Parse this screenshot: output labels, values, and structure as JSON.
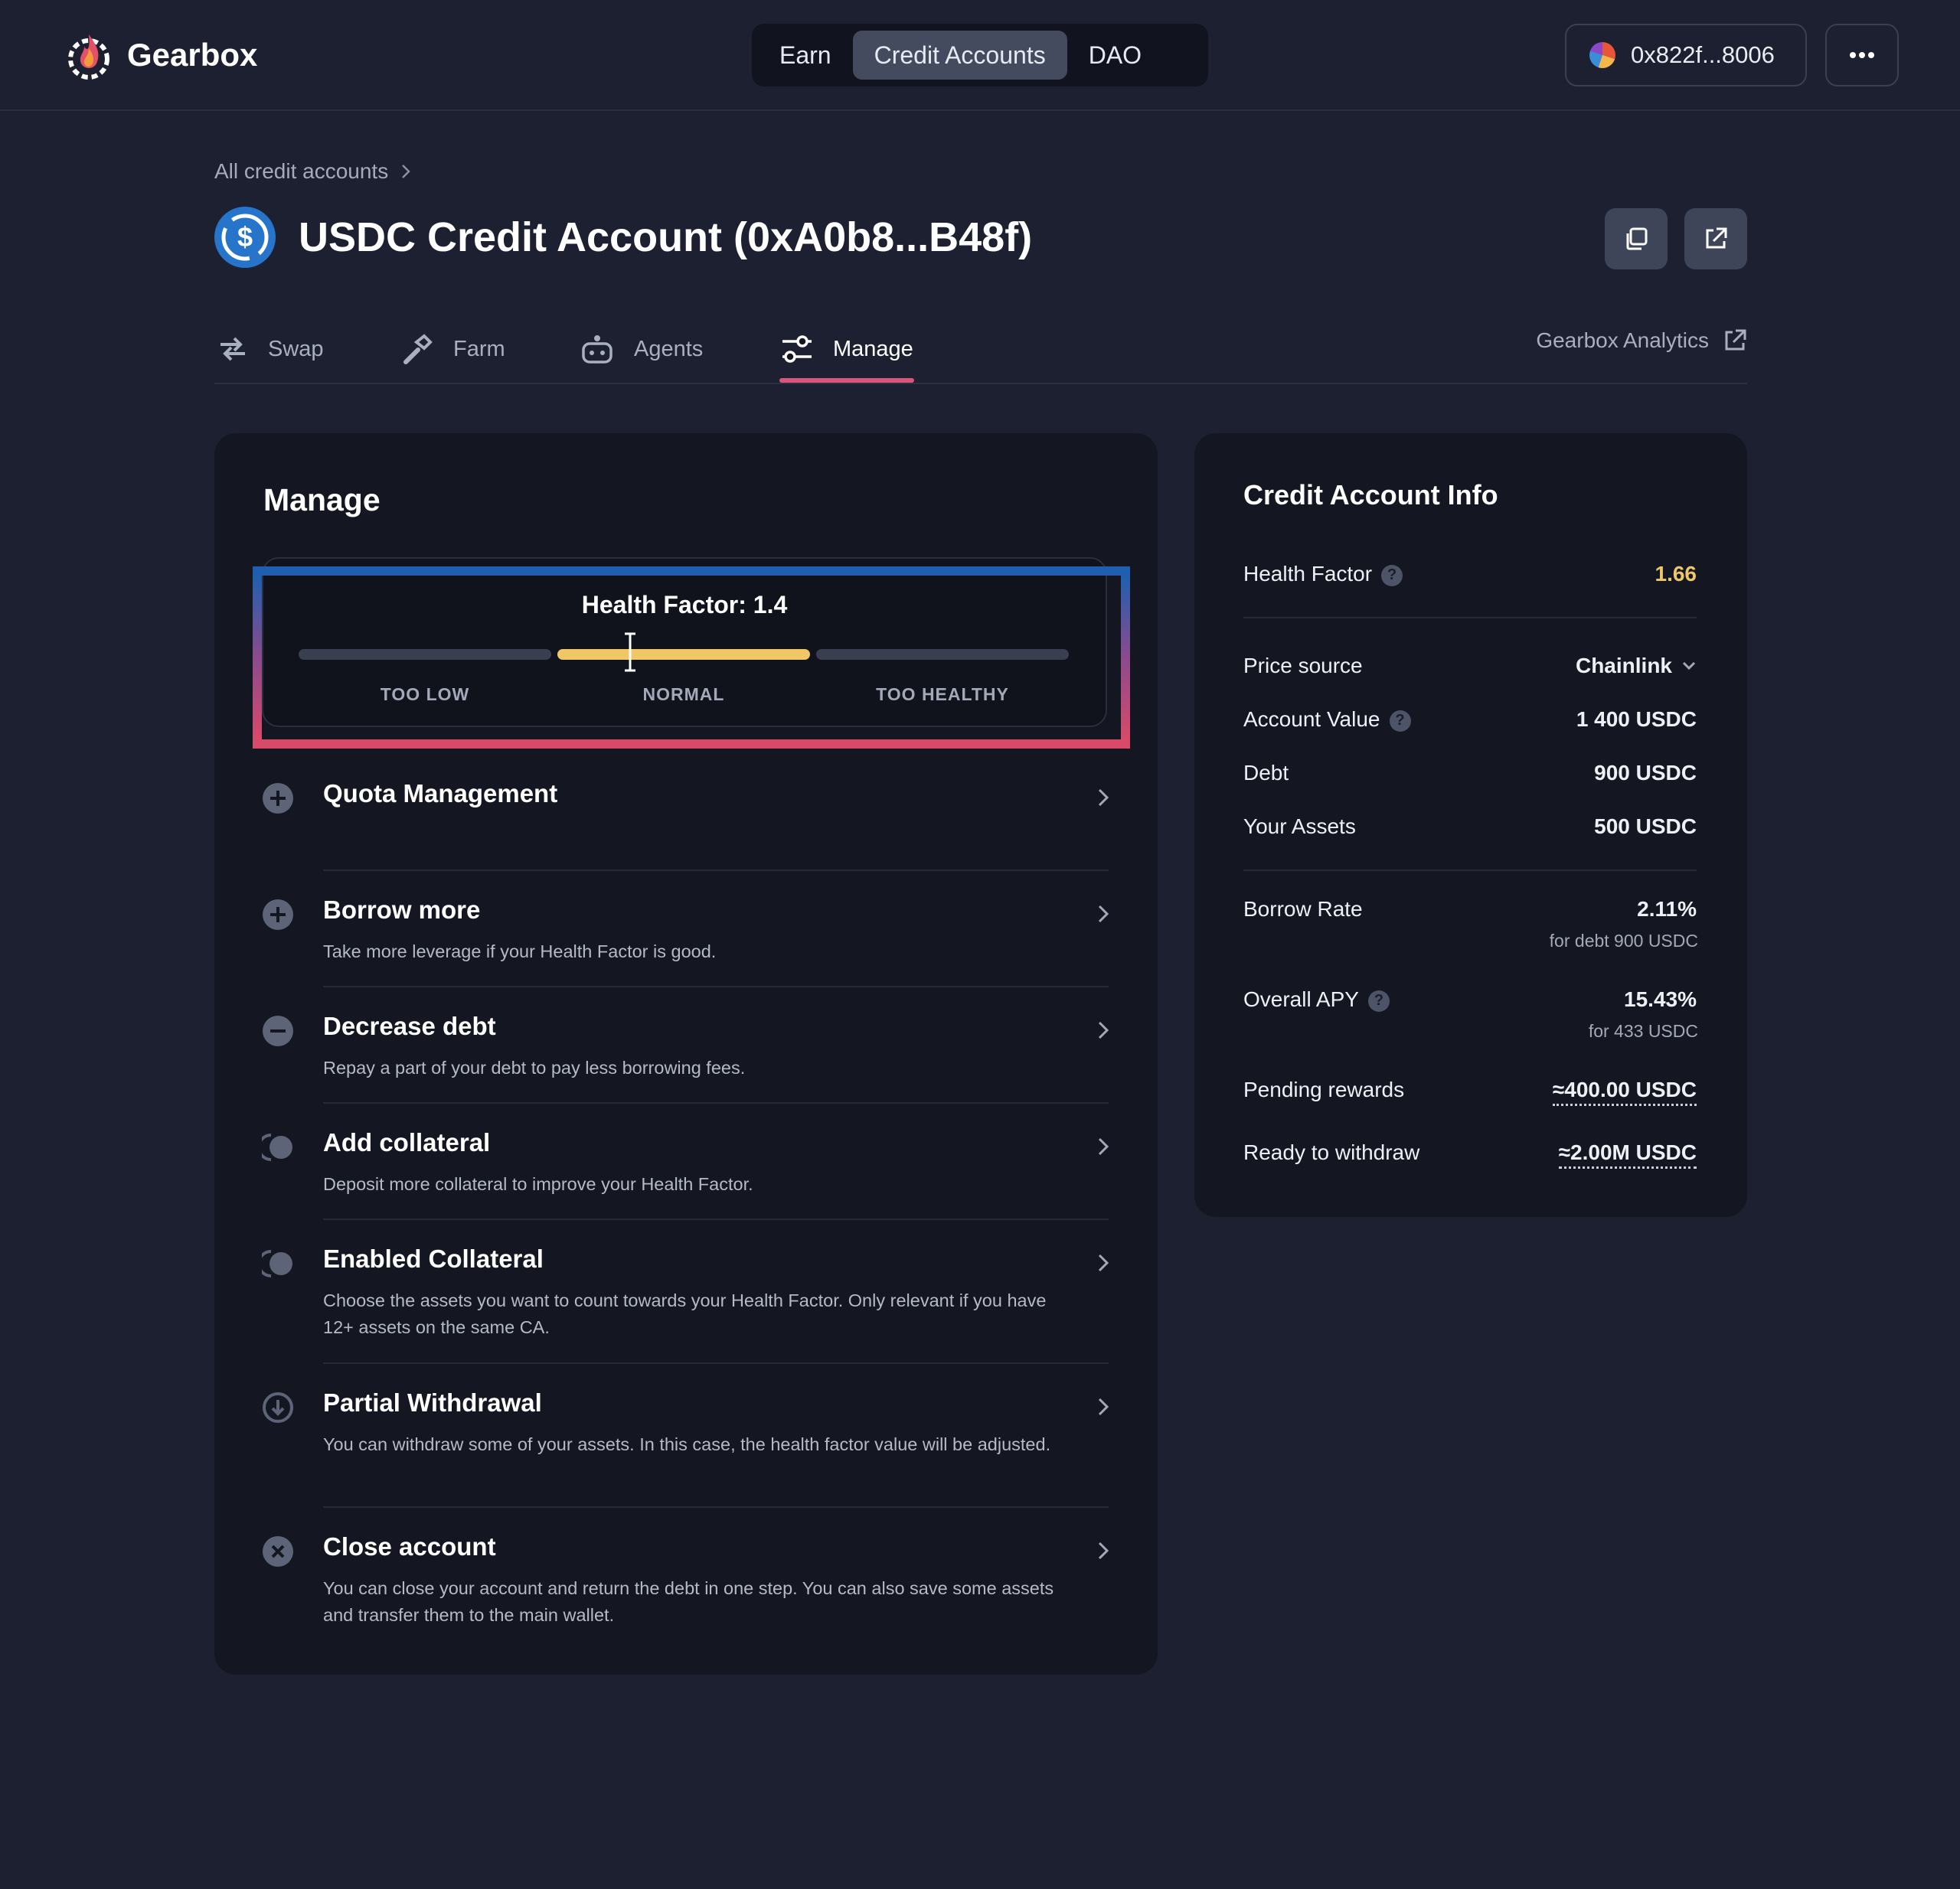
{
  "header": {
    "brand": "Gearbox",
    "nav": [
      "Earn",
      "Credit Accounts",
      "DAO"
    ],
    "nav_active": "Credit Accounts",
    "wallet_address": "0x822f...8006"
  },
  "breadcrumb": "All credit accounts",
  "page_title": "USDC Credit Account (0xA0b8...B48f)",
  "tabs": [
    {
      "label": "Swap",
      "icon": "swap-icon"
    },
    {
      "label": "Farm",
      "icon": "farm-icon"
    },
    {
      "label": "Agents",
      "icon": "robot-icon"
    },
    {
      "label": "Manage",
      "icon": "sliders-icon",
      "active": true
    }
  ],
  "analytics_link": "Gearbox Analytics",
  "manage": {
    "title": "Manage",
    "health_factor": {
      "label": "Health Factor: 1.4",
      "value": 1.4,
      "zones": [
        "TOO LOW",
        "NORMAL",
        "TOO HEALTHY"
      ],
      "active_zone": "NORMAL",
      "accent": "#f0c766"
    },
    "actions": [
      {
        "title": "Quota Management",
        "desc": "",
        "icon": "plus-circle-icon"
      },
      {
        "title": "Borrow more",
        "desc": "Take more leverage if your Health Factor is good.",
        "icon": "plus-circle-icon"
      },
      {
        "title": "Decrease debt",
        "desc": "Repay a part of your debt to pay less borrowing fees.",
        "icon": "minus-circle-icon"
      },
      {
        "title": "Add collateral",
        "desc": "Deposit more collateral to improve your Health Factor.",
        "icon": "coins-icon"
      },
      {
        "title": "Enabled Collateral",
        "desc": "Choose the assets you want to count towards your Health Factor. Only relevant if you have 12+ assets on the same CA.",
        "icon": "coins-icon"
      },
      {
        "title": "Partial Withdrawal",
        "desc": "You can withdraw some of your assets. In this case, the health factor value will be adjusted.",
        "icon": "download-circle-icon"
      },
      {
        "title": "Close account",
        "desc": "You can close your account and return the debt in one step. You can also save some assets and transfer them to the main wallet.",
        "icon": "close-circle-icon"
      }
    ]
  },
  "info": {
    "title": "Credit Account Info",
    "health_factor": {
      "label": "Health Factor",
      "value": "1.66",
      "color": "#f0c766"
    },
    "price_source": {
      "label": "Price source",
      "value": "Chainlink"
    },
    "account_value": {
      "label": "Account Value",
      "value": "1 400 USDC"
    },
    "debt": {
      "label": "Debt",
      "value": "900 USDC"
    },
    "your_assets": {
      "label": "Your Assets",
      "value": "500 USDC"
    },
    "borrow_rate": {
      "label": "Borrow Rate",
      "value": "2.11%",
      "sub": "for debt 900 USDC"
    },
    "overall_apy": {
      "label": "Overall APY",
      "value": "15.43%",
      "sub": "for 433 USDC"
    },
    "pending_rewards": {
      "label": "Pending rewards",
      "value": "≈400.00 USDC"
    },
    "ready_to_withdraw": {
      "label": "Ready to withdraw",
      "value": "≈2.00M USDC"
    }
  },
  "colors": {
    "background": "#1c2030",
    "panel": "#141722",
    "accent_tab": "#d9557e",
    "hf_normal": "#f0c766"
  }
}
